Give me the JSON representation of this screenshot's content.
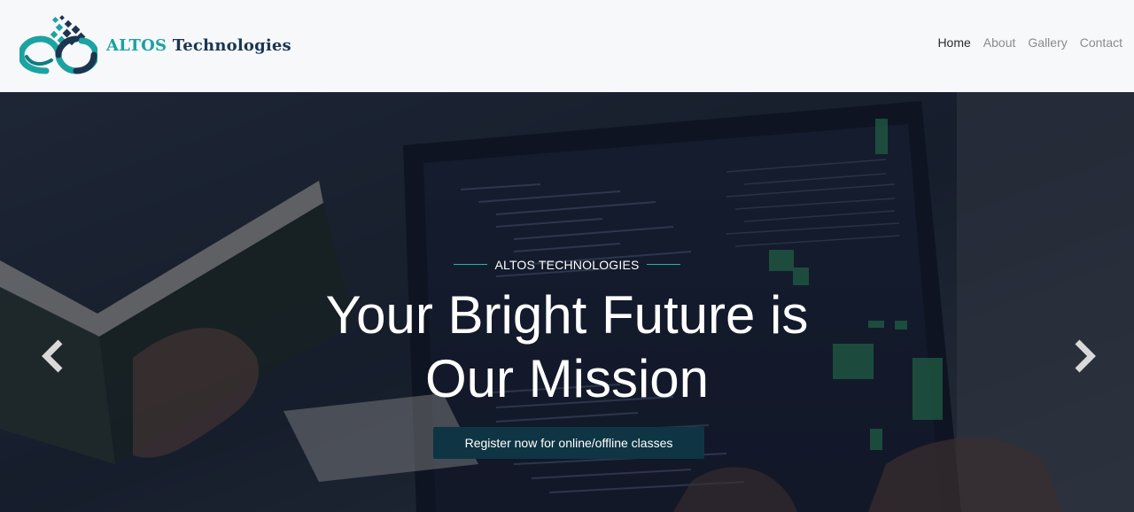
{
  "brand": {
    "name_part1": "ALTOS",
    "name_part2": "Technologies",
    "logo_icon": "infinity-pixel-logo",
    "colors": {
      "teal": "#1aa3a1",
      "navy": "#1b3550"
    }
  },
  "nav": {
    "items": [
      {
        "label": "Home",
        "active": true
      },
      {
        "label": "About",
        "active": false
      },
      {
        "label": "Gallery",
        "active": false
      },
      {
        "label": "Contact",
        "active": false
      }
    ]
  },
  "hero": {
    "eyebrow": "ALTOS TECHNOLOGIES",
    "headline_line1": "Your Bright Future is",
    "headline_line2": "Our Mission",
    "cta_label": "Register now for online/offline classes",
    "prev_icon": "chevron-left-icon",
    "next_icon": "chevron-right-icon",
    "background": "student reading book at laptop with code on screen",
    "colors": {
      "accent_line": "#1fb3ad",
      "cta_bg": "#0f3544"
    }
  }
}
